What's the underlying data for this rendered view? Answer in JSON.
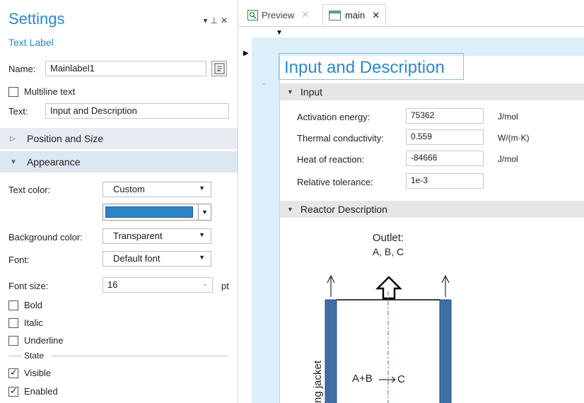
{
  "settings": {
    "title": "Settings",
    "subtitle": "Text Label",
    "name_label": "Name:",
    "name_value": "Mainlabel1",
    "multiline_label": "Multiline text",
    "text_label": "Text:",
    "text_value": "Input and Description",
    "position_section": "Position and Size",
    "appearance_section": "Appearance",
    "text_color_label": "Text color:",
    "text_color_value": "Custom",
    "custom_color": "#2f84c8",
    "bg_color_label": "Background color:",
    "bg_color_value": "Transparent",
    "font_label": "Font:",
    "font_value": "Default font",
    "font_size_label": "Font size:",
    "font_size_value": "16",
    "font_size_unit": "pt",
    "bold_label": "Bold",
    "italic_label": "Italic",
    "underline_label": "Underline",
    "state_label": "State",
    "visible_label": "Visible",
    "enabled_label": "Enabled"
  },
  "tabs": [
    {
      "label": "Preview"
    },
    {
      "label": "main"
    }
  ],
  "editor": {
    "title": "Input and Description",
    "input_section": "Input",
    "inputs": [
      {
        "label": "Activation energy:",
        "value": "75362",
        "unit": "J/mol"
      },
      {
        "label": "Thermal conductivity:",
        "value": "0.559",
        "unit": "W/(m·K)"
      },
      {
        "label": "Heat of reaction:",
        "value": "-84666",
        "unit": "J/mol"
      },
      {
        "label": "Relative tolerance:",
        "value": "1e-3",
        "unit": ""
      }
    ],
    "reactor_section": "Reactor Description",
    "diagram": {
      "outlet_label": "Outlet:",
      "outlet_species": "A, B, C",
      "reaction": "A+B",
      "product": "C",
      "jacket_label": "ng jacket"
    }
  }
}
